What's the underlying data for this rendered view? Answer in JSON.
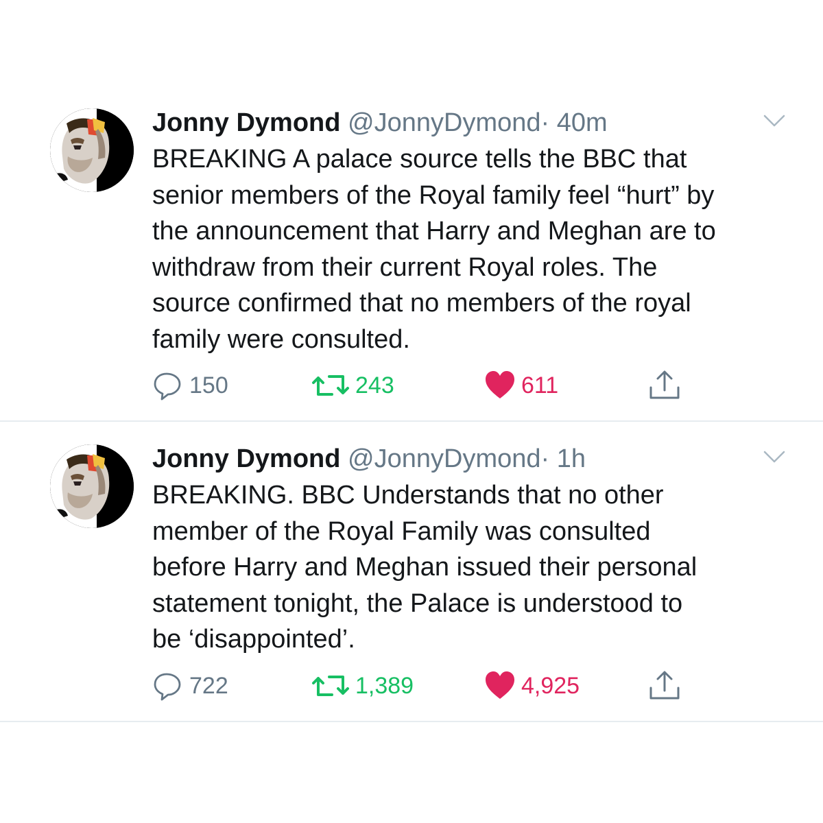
{
  "tweets": [
    {
      "author_name": "Jonny Dymond",
      "handle": "@JonnyDymond",
      "separator": "·",
      "time": "40m",
      "text": "BREAKING A palace source tells the BBC that\nsenior members of the Royal family feel “hurt” by\nthe announcement that Harry and Meghan are to\nwithdraw from their current Royal roles. The\nsource confirmed that no members  of the royal\nfamily were consulted.",
      "replies": "150",
      "retweets": "243",
      "likes": "611"
    },
    {
      "author_name": "Jonny Dymond",
      "handle": "@JonnyDymond",
      "separator": "·",
      "time": "1h",
      "text": "BREAKING. BBC Understands that no other\nmember of the Royal Family was consulted\nbefore Harry and Meghan issued their personal\nstatement tonight, the Palace is understood to\nbe ‘disappointed’.",
      "replies": "722",
      "retweets": "1,389",
      "likes": "4,925"
    }
  ],
  "icons": {
    "reply": "reply-icon",
    "retweet": "retweet-icon",
    "like": "heart-icon",
    "share": "share-icon",
    "caret": "chevron-down-icon"
  },
  "colors": {
    "text": "#14171a",
    "secondary": "#657786",
    "retweet": "#17bf63",
    "like": "#e0245e",
    "divider": "#e6ecf0"
  }
}
